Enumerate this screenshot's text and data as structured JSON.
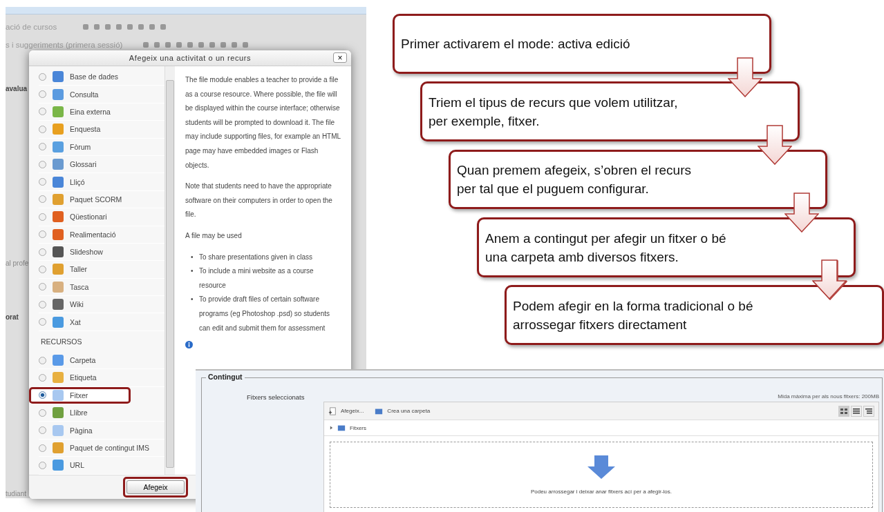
{
  "background_page": {
    "course_rows": [
      {
        "text": "ació de cursos"
      },
      {
        "text": "s i suggeriments (primera sessió)"
      }
    ],
    "side_labels": [
      {
        "text": "avalua",
        "kind": "heading"
      },
      {
        "text": "al profe",
        "kind": "text"
      },
      {
        "text": "orat",
        "kind": "heading"
      },
      {
        "text": "tudiant",
        "kind": "text"
      }
    ]
  },
  "dialog": {
    "title": "Afegeix una activitat o un recurs",
    "close": "×",
    "activities": [
      {
        "label": "Base de dades",
        "selected": false
      },
      {
        "label": "Consulta",
        "selected": false
      },
      {
        "label": "Eina externa",
        "selected": false
      },
      {
        "label": "Enquesta",
        "selected": false
      },
      {
        "label": "Fòrum",
        "selected": false
      },
      {
        "label": "Glossari",
        "selected": false
      },
      {
        "label": "Lliçó",
        "selected": false
      },
      {
        "label": "Paquet SCORM",
        "selected": false
      },
      {
        "label": "Qüestionari",
        "selected": false
      },
      {
        "label": "Realimentació",
        "selected": false
      },
      {
        "label": "Slideshow",
        "selected": false
      },
      {
        "label": "Taller",
        "selected": false
      },
      {
        "label": "Tasca",
        "selected": false
      },
      {
        "label": "Wiki",
        "selected": false
      },
      {
        "label": "Xat",
        "selected": false
      }
    ],
    "resources_heading": "RECURSOS",
    "resources": [
      {
        "label": "Carpeta",
        "selected": false
      },
      {
        "label": "Etiqueta",
        "selected": false
      },
      {
        "label": "Fitxer",
        "selected": true
      },
      {
        "label": "Llibre",
        "selected": false
      },
      {
        "label": "Pàgina",
        "selected": false
      },
      {
        "label": "Paquet de contingut IMS",
        "selected": false
      },
      {
        "label": "URL",
        "selected": false
      }
    ],
    "description": [
      "The file module enables a teacher to provide a file as a course resource. Where possible, the file will be displayed within the course interface; otherwise students will be prompted to download it. The file may include supporting files, for example an HTML page may have embedded images or Flash objects.",
      "Note that students need to have the appropriate software on their computers in order to open the file.",
      "A file may be used"
    ],
    "uses": [
      {
        "marker": "•",
        "text": "To share presentations given in class"
      },
      {
        "marker": "•",
        "text": "To include a mini website as a course resource"
      },
      {
        "marker": "•",
        "text": "To provide draft files of certain software programs (eg Photoshop .psd) so students can edit and submit them for assessment"
      }
    ],
    "add_button": "Afegeix"
  },
  "content_panel": {
    "legend": "Contingut",
    "field_label": "Fitxers seleccionats",
    "max_size": "Mida màxima per als nous fitxers: 200MB",
    "add_file": "Afegeix...",
    "create_folder": "Crea una carpeta",
    "path": "Fitxers",
    "drop_hint": "Podeu arrossegar i deixar anar fitxers ací per a afegir-los."
  },
  "steps": [
    {
      "text": "Primer activarem el mode: activa edició"
    },
    {
      "text": "Triem el tipus de recurs que volem utilitzar, per exemple, fitxer."
    },
    {
      "text": "Quan premem afegeix, s’obren el recurs per tal que el puguem configurar."
    },
    {
      "text": "Anem a contingut per afegir un fitxer o bé una carpeta amb diversos fitxers."
    },
    {
      "text": "Podem afegir en la forma tradicional o bé arrossegar fitxers directament"
    }
  ]
}
